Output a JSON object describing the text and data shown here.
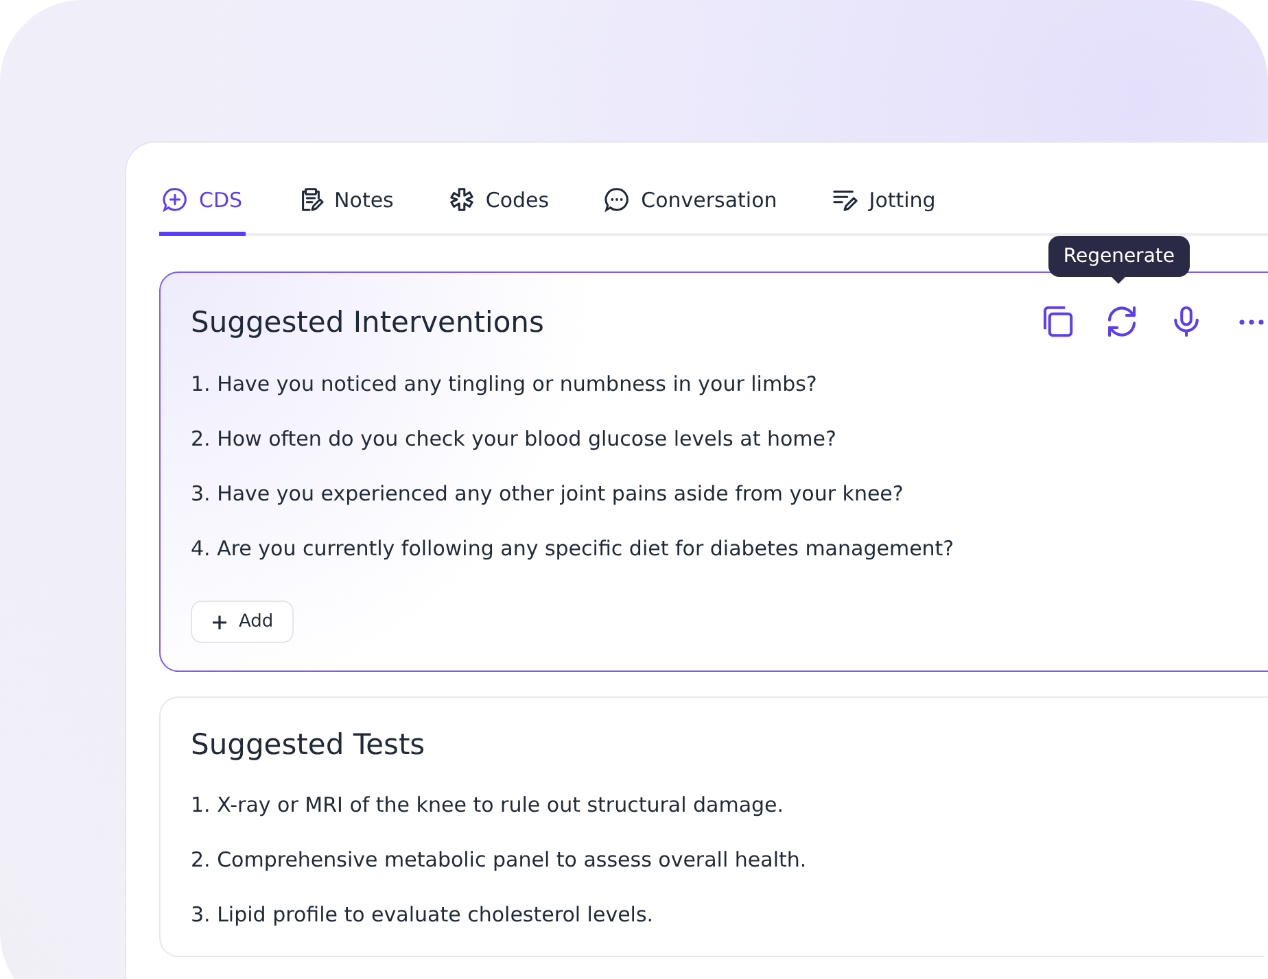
{
  "tabs": [
    {
      "label": "CDS",
      "kind": "cds",
      "selected": true
    },
    {
      "label": "Notes",
      "kind": "notes",
      "selected": false
    },
    {
      "label": "Codes",
      "kind": "codes",
      "selected": false
    },
    {
      "label": "Conversation",
      "kind": "chat",
      "selected": false
    },
    {
      "label": "Jotting",
      "kind": "jot",
      "selected": false
    }
  ],
  "sections": [
    {
      "title": "Suggested Interventions",
      "selected": true,
      "tooltip": "Regenerate",
      "items": [
        "1. Have you noticed any tingling or numbness in your limbs?",
        "2. How often do you check your blood glucose levels at home?",
        "3. Have you experienced any other joint pains aside from your knee?",
        "4. Are you currently following any specific diet for diabetes management?"
      ],
      "add_label": "Add"
    },
    {
      "title": "Suggested Tests",
      "selected": false,
      "items": [
        "1. X-ray or MRI of the knee to rule out structural damage.",
        "2. Comprehensive metabolic panel to assess overall health.",
        "3. Lipid profile to evaluate cholesterol levels."
      ]
    }
  ]
}
